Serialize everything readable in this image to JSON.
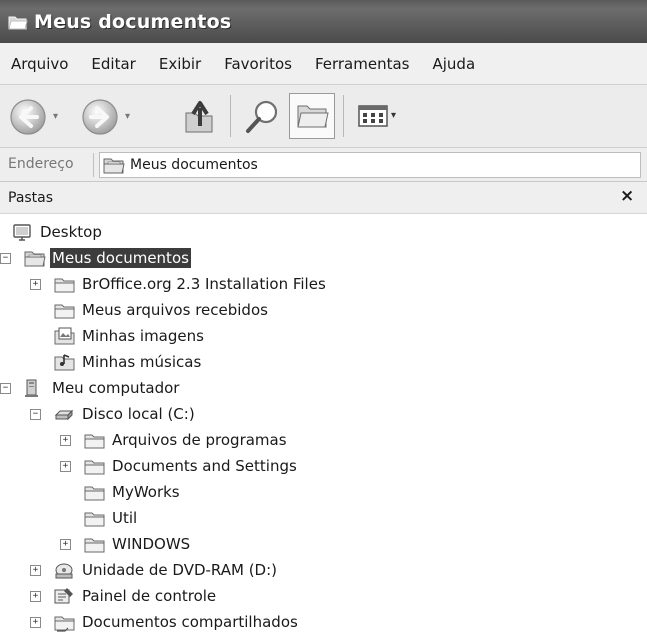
{
  "window": {
    "title": "Meus documentos",
    "title_icon": "folder-open-icon"
  },
  "menubar": {
    "items": [
      "Arquivo",
      "Editar",
      "Exibir",
      "Favoritos",
      "Ferramentas",
      "Ajuda"
    ]
  },
  "toolbar": {
    "buttons": [
      {
        "name": "back-icon"
      },
      {
        "name": "forward-icon"
      },
      {
        "name": "up-folder-icon"
      },
      {
        "name": "search-icon"
      },
      {
        "name": "folders-icon",
        "pressed": true
      },
      {
        "name": "views-icon"
      }
    ]
  },
  "addressbar": {
    "label": "Endereço",
    "value": "Meus documentos",
    "icon": "my-documents-icon"
  },
  "folders_pane": {
    "title": "Pastas",
    "close_glyph": "×"
  },
  "tree": {
    "nodes": [
      {
        "label": "Desktop",
        "icon": "desktop-icon",
        "level": 0,
        "expander": "none",
        "selected": false
      },
      {
        "label": "Meus documentos",
        "icon": "my-documents-icon",
        "level": 1,
        "expander": "minus",
        "selected": true
      },
      {
        "label": "BrOffice.org 2.3 Installation Files",
        "icon": "folder-icon",
        "level": 2,
        "expander": "plus",
        "selected": false
      },
      {
        "label": "Meus arquivos recebidos",
        "icon": "folder-icon",
        "level": 2,
        "expander": "none",
        "selected": false
      },
      {
        "label": "Minhas imagens",
        "icon": "pictures-folder-icon",
        "level": 2,
        "expander": "none",
        "selected": false
      },
      {
        "label": "Minhas músicas",
        "icon": "music-folder-icon",
        "level": 2,
        "expander": "none",
        "selected": false
      },
      {
        "label": "Meu computador",
        "icon": "computer-icon",
        "level": 1,
        "expander": "minus",
        "selected": false
      },
      {
        "label": "Disco local (C:)",
        "icon": "hard-drive-icon",
        "level": 2,
        "expander": "minus",
        "selected": false
      },
      {
        "label": "Arquivos de programas",
        "icon": "folder-icon",
        "level": 3,
        "expander": "plus",
        "selected": false
      },
      {
        "label": "Documents and Settings",
        "icon": "folder-icon",
        "level": 3,
        "expander": "plus",
        "selected": false
      },
      {
        "label": "MyWorks",
        "icon": "folder-icon",
        "level": 3,
        "expander": "none",
        "selected": false
      },
      {
        "label": "Util",
        "icon": "folder-icon",
        "level": 3,
        "expander": "none",
        "selected": false
      },
      {
        "label": "WINDOWS",
        "icon": "folder-icon",
        "level": 3,
        "expander": "plus",
        "selected": false
      },
      {
        "label": "Unidade de DVD-RAM (D:)",
        "icon": "dvd-drive-icon",
        "level": 2,
        "expander": "plus",
        "selected": false
      },
      {
        "label": "Painel de controle",
        "icon": "control-panel-icon",
        "level": 2,
        "expander": "plus",
        "selected": false
      },
      {
        "label": "Documentos compartilhados",
        "icon": "shared-folder-icon",
        "level": 2,
        "expander": "plus",
        "selected": false
      }
    ]
  }
}
